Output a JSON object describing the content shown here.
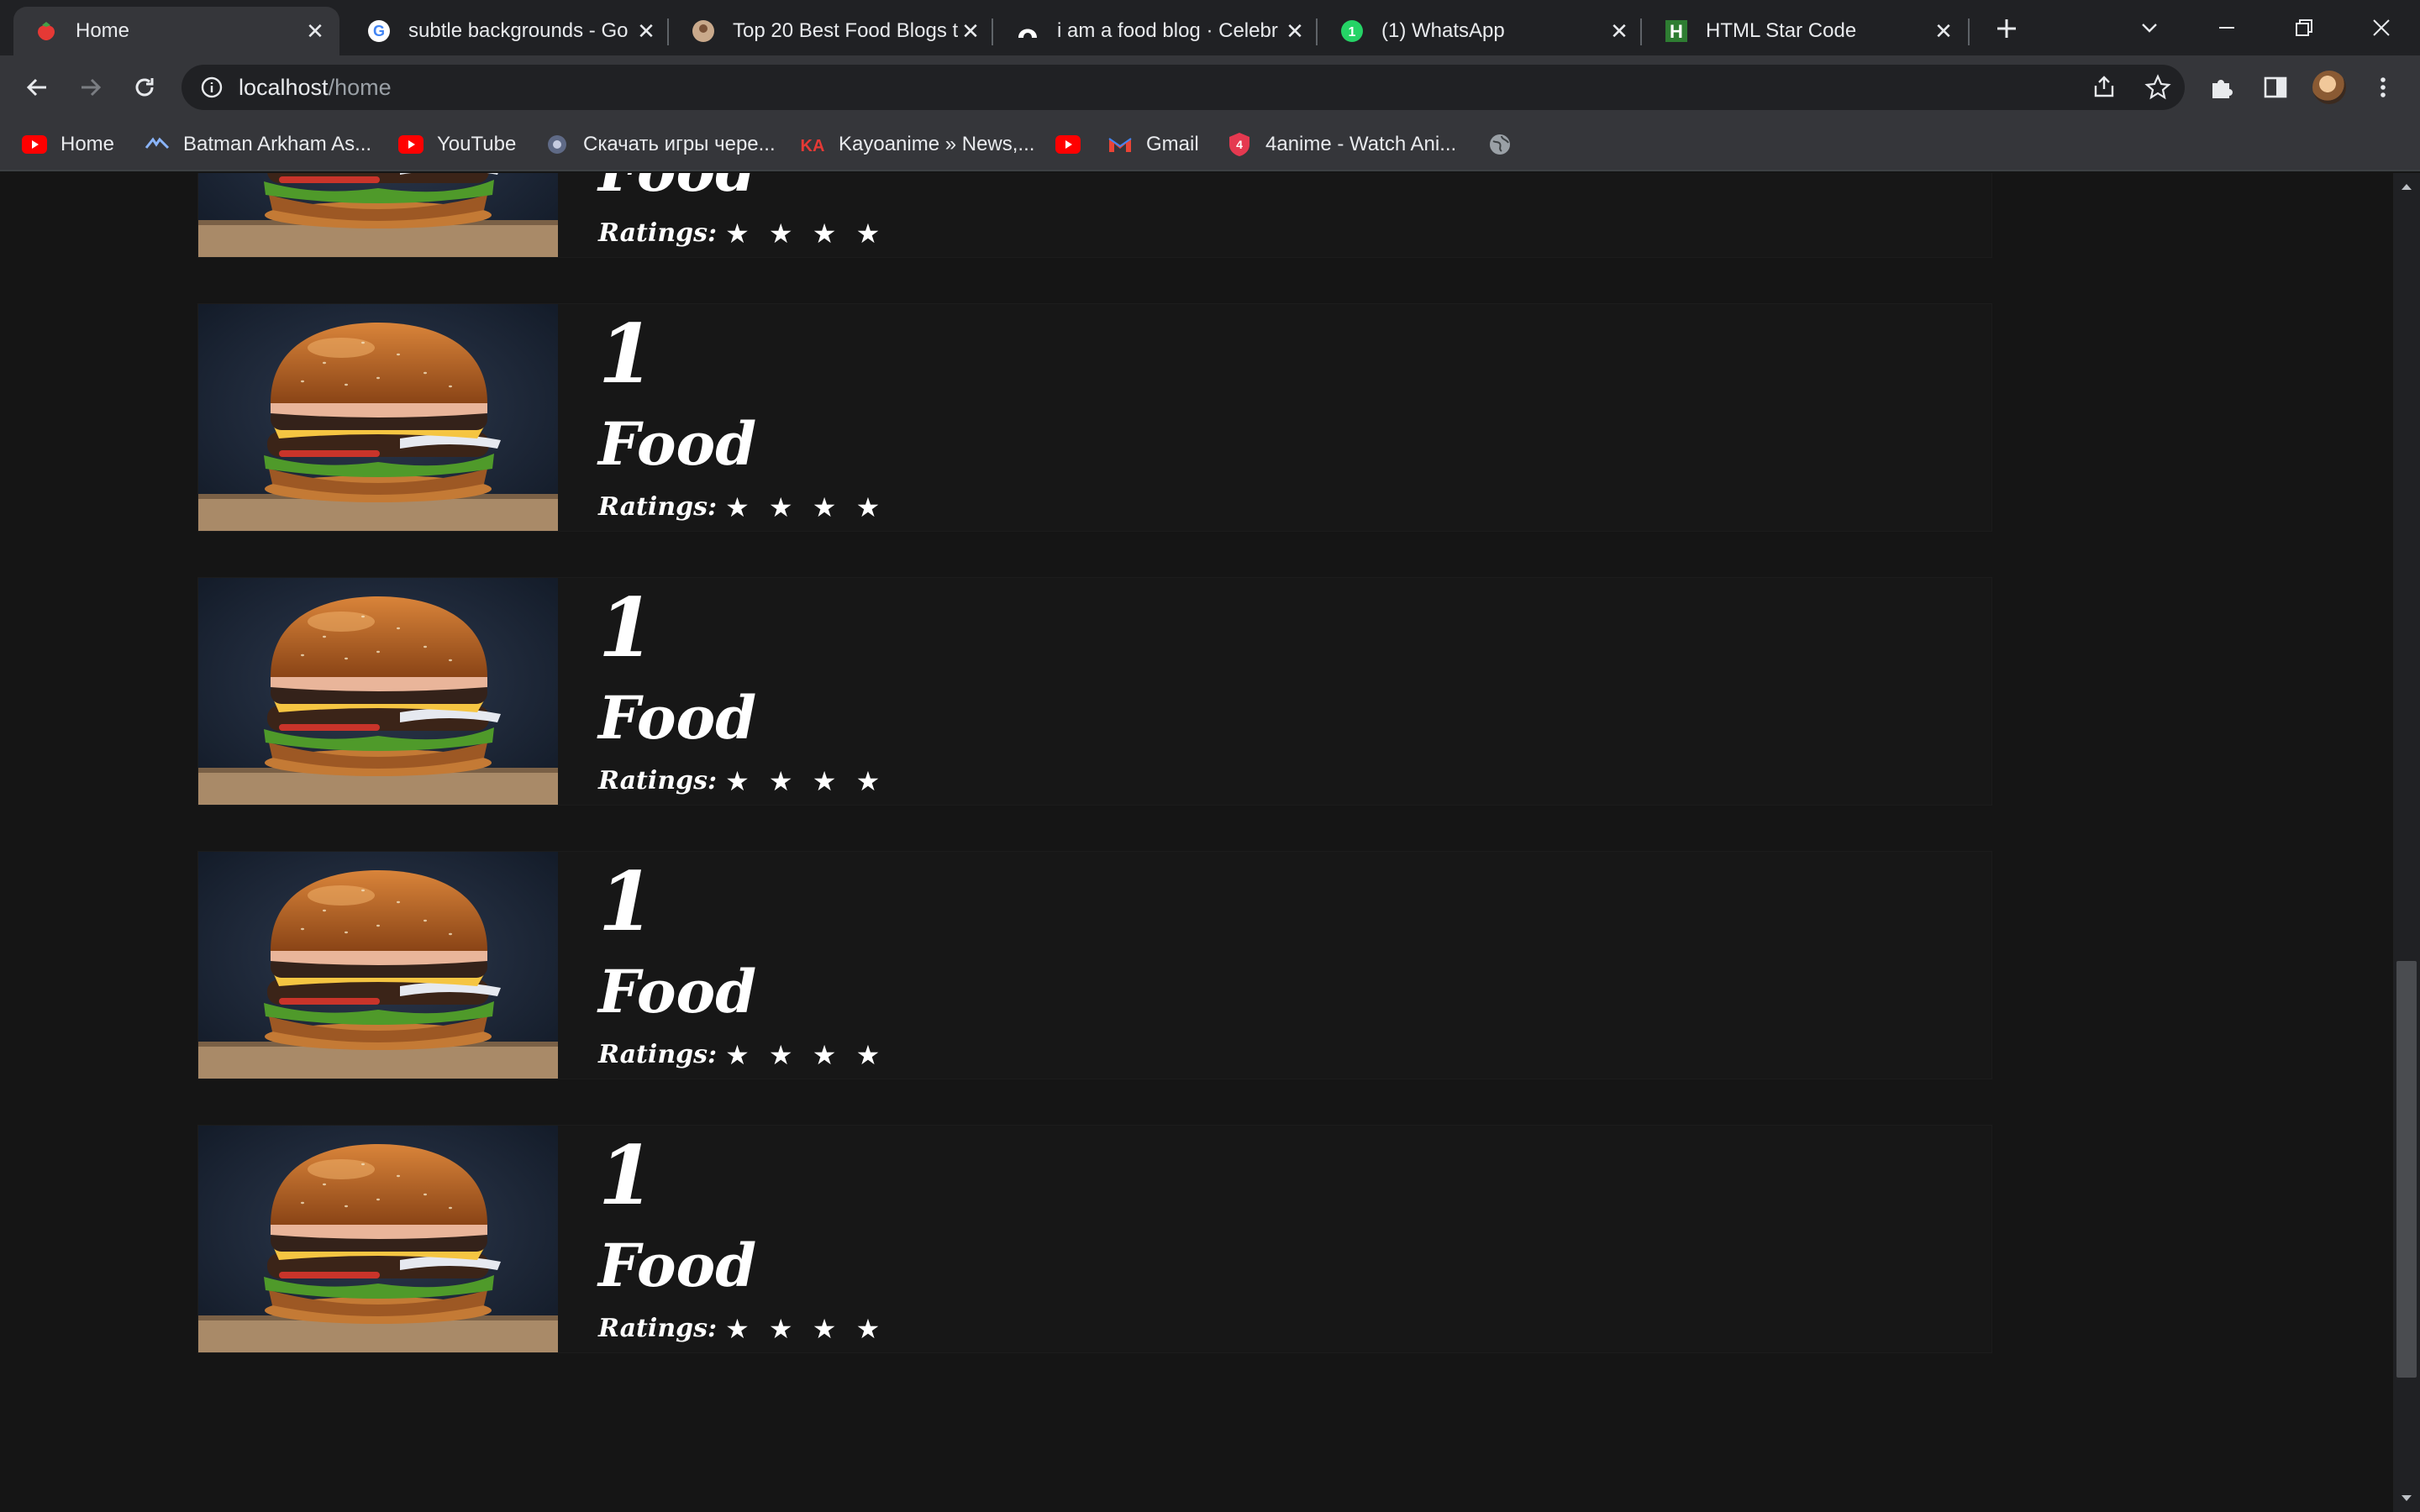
{
  "browser": {
    "tabs": [
      {
        "title": "Home",
        "icon": "strawberry-icon",
        "active": true
      },
      {
        "title": "subtle backgrounds - Go",
        "icon": "google-icon",
        "active": false
      },
      {
        "title": "Top 20 Best Food Blogs t",
        "icon": "avatar-icon",
        "active": false
      },
      {
        "title": "i am a food blog · Celebr",
        "icon": "foodblog-icon",
        "active": false
      },
      {
        "title": "(1) WhatsApp",
        "icon": "whatsapp-icon",
        "active": false
      },
      {
        "title": "HTML Star Code",
        "icon": "h-icon",
        "active": false
      }
    ],
    "whatsapp_badge": "1",
    "address": {
      "host": "localhost",
      "path": "/home"
    },
    "bookmarks": [
      {
        "label": "Home",
        "icon": "youtube-icon"
      },
      {
        "label": "Batman Arkham As...",
        "icon": "batman-icon"
      },
      {
        "label": "YouTube",
        "icon": "youtube-icon"
      },
      {
        "label": "Скачать игры чере...",
        "icon": "gear-icon"
      },
      {
        "label": "Kayoanime » News,...",
        "icon": "ka-icon"
      },
      {
        "label": "",
        "icon": "youtube-icon"
      },
      {
        "label": "Gmail",
        "icon": "gmail-icon"
      },
      {
        "label": "4anime - Watch Ani...",
        "icon": "4anime-icon"
      },
      {
        "label": "",
        "icon": "globe-icon"
      }
    ]
  },
  "page": {
    "ratings_label": "Ratings:",
    "stars": "★ ★ ★ ★",
    "star_count": 4,
    "items": [
      {
        "number": "1",
        "name": "Food"
      },
      {
        "number": "1",
        "name": "Food"
      },
      {
        "number": "1",
        "name": "Food"
      },
      {
        "number": "1",
        "name": "Food"
      },
      {
        "number": "1",
        "name": "Food"
      }
    ]
  },
  "colors": {
    "page_bg": "#151515",
    "card_bg": "#171717",
    "text": "#ffffff",
    "chrome_dark": "#202124",
    "chrome_light": "#35363a"
  }
}
